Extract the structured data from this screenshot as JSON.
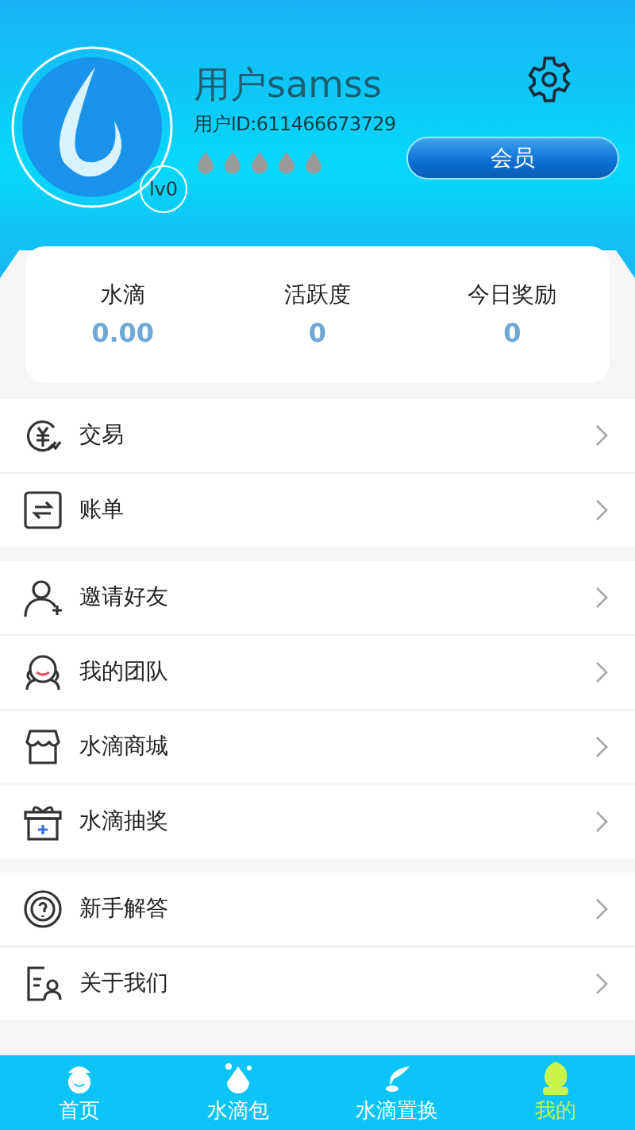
{
  "profile": {
    "name": "用户samss",
    "user_id": "用户ID:611466673729",
    "level_badge": "lv0",
    "member_button": "会员"
  },
  "stats": [
    {
      "label": "水滴",
      "value": "0.00"
    },
    {
      "label": "活跃度",
      "value": "0"
    },
    {
      "label": "今日奖励",
      "value": "0"
    }
  ],
  "menu_groups": [
    [
      {
        "kind": "trade",
        "label": "交易"
      },
      {
        "kind": "bill",
        "label": "账单"
      }
    ],
    [
      {
        "kind": "invite",
        "label": "邀请好友"
      },
      {
        "kind": "team",
        "label": "我的团队"
      },
      {
        "kind": "shop",
        "label": "水滴商城"
      },
      {
        "kind": "lottery",
        "label": "水滴抽奖"
      }
    ],
    [
      {
        "kind": "help",
        "label": "新手解答"
      },
      {
        "kind": "about",
        "label": "关于我们"
      }
    ]
  ],
  "tabs": [
    {
      "kind": "home",
      "label": "首页",
      "selected": false
    },
    {
      "kind": "bag",
      "label": "水滴包",
      "selected": false
    },
    {
      "kind": "swap",
      "label": "水滴置换",
      "selected": false
    },
    {
      "kind": "me",
      "label": "我的",
      "selected": true
    }
  ]
}
